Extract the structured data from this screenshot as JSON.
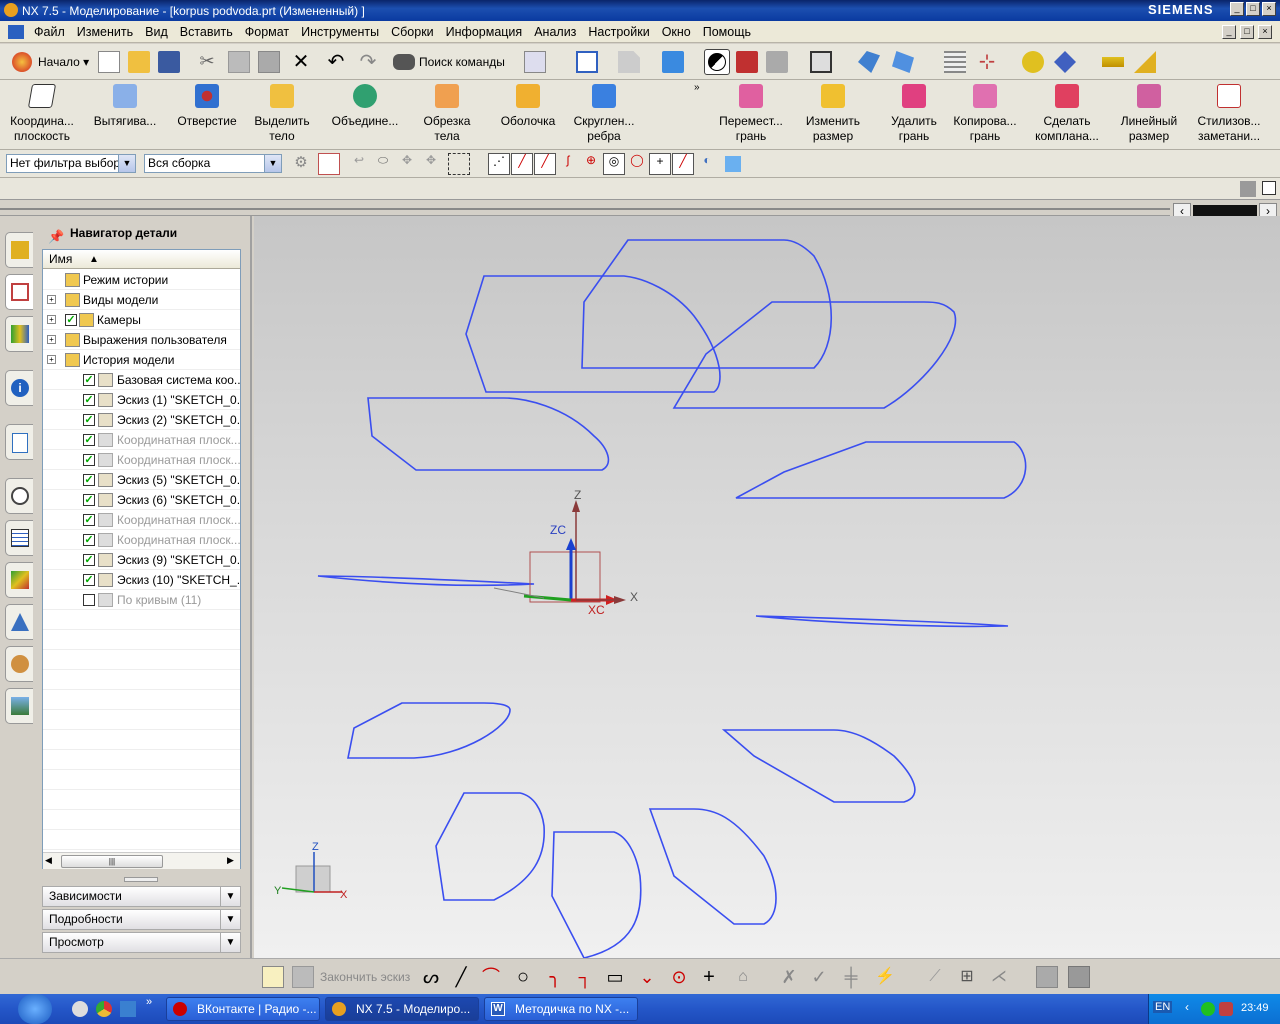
{
  "window": {
    "title": "NX 7.5 - Моделирование - [korpus podvoda.prt (Измененный) ]",
    "brand": "SIEMENS"
  },
  "menu": [
    "Файл",
    "Изменить",
    "Вид",
    "Вставить",
    "Формат",
    "Инструменты",
    "Сборки",
    "Информация",
    "Анализ",
    "Настройки",
    "Окно",
    "Помощь"
  ],
  "toolbar1": {
    "start": "Начало",
    "search": "Поиск команды"
  },
  "toolbar2": [
    {
      "label": "Координа... плоскость"
    },
    {
      "label": "Вытягива..."
    },
    {
      "label": "Отверстие"
    },
    {
      "label": "Выделить тело"
    },
    {
      "label": "Объедине..."
    },
    {
      "label": "Обрезка тела"
    },
    {
      "label": "Оболочка"
    },
    {
      "label": "Скруглен... ребра"
    },
    {
      "label": "Перемест... грань"
    },
    {
      "label": "Изменить размер"
    },
    {
      "label": "Удалить грань"
    },
    {
      "label": "Копирова... грань"
    },
    {
      "label": "Сделать компланa..."
    },
    {
      "label": "Линейный размер"
    },
    {
      "label": "Стилизов... заметани..."
    }
  ],
  "filter": {
    "type": "Нет фильтра выбор",
    "scope": "Вся сборка"
  },
  "navigator": {
    "title": "Навигатор детали",
    "column": "Имя",
    "rows": [
      {
        "label": "Режим истории",
        "indent": 0,
        "gray": false,
        "check": false,
        "plus": false
      },
      {
        "label": "Виды модели",
        "indent": 0,
        "gray": false,
        "check": false,
        "plus": true
      },
      {
        "label": "Камеры",
        "indent": 0,
        "gray": false,
        "check": true,
        "plus": true
      },
      {
        "label": "Выражения пользователя",
        "indent": 0,
        "gray": false,
        "check": false,
        "plus": true
      },
      {
        "label": "История модели",
        "indent": 0,
        "gray": false,
        "check": false,
        "plus": true
      },
      {
        "label": "Базовая система коо...",
        "indent": 1,
        "gray": false,
        "check": true
      },
      {
        "label": "Эскиз (1) \"SKETCH_0...",
        "indent": 1,
        "gray": false,
        "check": true
      },
      {
        "label": "Эскиз (2) \"SKETCH_0...",
        "indent": 1,
        "gray": false,
        "check": true
      },
      {
        "label": "Координатная плоск...",
        "indent": 1,
        "gray": true,
        "check": true
      },
      {
        "label": "Координатная плоск...",
        "indent": 1,
        "gray": true,
        "check": true
      },
      {
        "label": "Эскиз (5) \"SKETCH_0...",
        "indent": 1,
        "gray": false,
        "check": true
      },
      {
        "label": "Эскиз (6) \"SKETCH_0...",
        "indent": 1,
        "gray": false,
        "check": true
      },
      {
        "label": "Координатная плоск...",
        "indent": 1,
        "gray": true,
        "check": true
      },
      {
        "label": "Координатная плоск...",
        "indent": 1,
        "gray": true,
        "check": true
      },
      {
        "label": "Эскиз (9) \"SKETCH_0...",
        "indent": 1,
        "gray": false,
        "check": true
      },
      {
        "label": "Эскиз (10) \"SKETCH_...",
        "indent": 1,
        "gray": false,
        "check": true
      },
      {
        "label": "По кривым (11)",
        "indent": 1,
        "gray": true,
        "check": false
      }
    ],
    "panels": [
      "Зависимости",
      "Подробности",
      "Просмотр"
    ]
  },
  "axes": {
    "z": "Z",
    "zc": "ZC",
    "xc": "XC",
    "x": "X",
    "small_z": "Z",
    "small_x": "X",
    "small_y": "Y"
  },
  "bottom": {
    "finish_sketch": "Закончить эскиз"
  },
  "taskbar": {
    "tasks": [
      "ВКонтакте | Радио -...",
      "NX 7.5 - Моделиро...",
      "Методичка по NX -..."
    ],
    "lang": "EN",
    "time": "23:49"
  }
}
